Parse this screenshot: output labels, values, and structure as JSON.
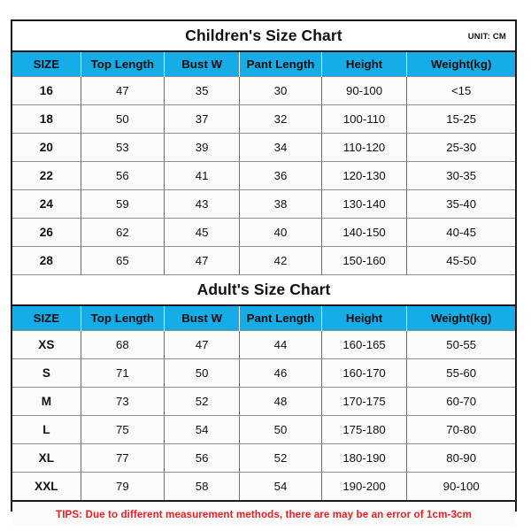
{
  "document": {
    "unit_label": "UNIT: CM",
    "accent_color": "#16ace8",
    "tips_color": "#ee1c22",
    "border_color": "#1a1a1a"
  },
  "columns": {
    "size": "SIZE",
    "top_length": "Top Length",
    "bust_w": "Bust W",
    "pant_length": "Pant Length",
    "height": "Height",
    "weight": "Weight(kg)"
  },
  "children": {
    "title": "Children's Size Chart",
    "headers": [
      "SIZE",
      "Top Length",
      "Bust W",
      "Pant Length",
      "Height",
      "Weight(kg)"
    ],
    "rows": [
      {
        "size": "16",
        "top_length": "47",
        "bust_w": "35",
        "pant_length": "30",
        "height": "90-100",
        "weight": "<15"
      },
      {
        "size": "18",
        "top_length": "50",
        "bust_w": "37",
        "pant_length": "32",
        "height": "100-110",
        "weight": "15-25"
      },
      {
        "size": "20",
        "top_length": "53",
        "bust_w": "39",
        "pant_length": "34",
        "height": "110-120",
        "weight": "25-30"
      },
      {
        "size": "22",
        "top_length": "56",
        "bust_w": "41",
        "pant_length": "36",
        "height": "120-130",
        "weight": "30-35"
      },
      {
        "size": "24",
        "top_length": "59",
        "bust_w": "43",
        "pant_length": "38",
        "height": "130-140",
        "weight": "35-40"
      },
      {
        "size": "26",
        "top_length": "62",
        "bust_w": "45",
        "pant_length": "40",
        "height": "140-150",
        "weight": "40-45"
      },
      {
        "size": "28",
        "top_length": "65",
        "bust_w": "47",
        "pant_length": "42",
        "height": "150-160",
        "weight": "45-50"
      }
    ]
  },
  "adult": {
    "title": "Adult's Size Chart",
    "headers": [
      "SIZE",
      "Top Length",
      "Bust W",
      "Pant Length",
      "Height",
      "Weight(kg)"
    ],
    "rows": [
      {
        "size": "XS",
        "top_length": "68",
        "bust_w": "47",
        "pant_length": "44",
        "height": "160-165",
        "weight": "50-55"
      },
      {
        "size": "S",
        "top_length": "71",
        "bust_w": "50",
        "pant_length": "46",
        "height": "160-170",
        "weight": "55-60"
      },
      {
        "size": "M",
        "top_length": "73",
        "bust_w": "52",
        "pant_length": "48",
        "height": "170-175",
        "weight": "60-70"
      },
      {
        "size": "L",
        "top_length": "75",
        "bust_w": "54",
        "pant_length": "50",
        "height": "175-180",
        "weight": "70-80"
      },
      {
        "size": "XL",
        "top_length": "77",
        "bust_w": "56",
        "pant_length": "52",
        "height": "180-190",
        "weight": "80-90"
      },
      {
        "size": "XXL",
        "top_length": "79",
        "bust_w": "58",
        "pant_length": "54",
        "height": "190-200",
        "weight": "90-100"
      }
    ]
  },
  "footer": {
    "tips": "TIPS: Due to different measurement methods, there are may be an error of 1cm-3cm"
  }
}
